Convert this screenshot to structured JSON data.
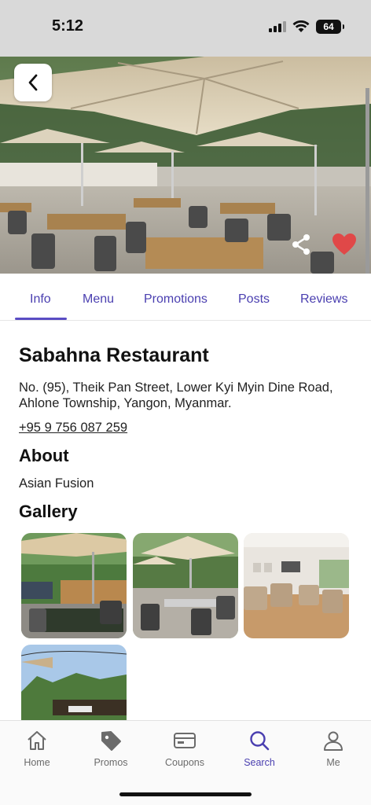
{
  "status_bar": {
    "time": "5:12",
    "battery": "64"
  },
  "tabs": [
    {
      "label": "Info",
      "active": true
    },
    {
      "label": "Menu",
      "active": false
    },
    {
      "label": "Promotions",
      "active": false
    },
    {
      "label": "Posts",
      "active": false
    },
    {
      "label": "Reviews",
      "active": false
    }
  ],
  "restaurant": {
    "name": "Sabahna Restaurant",
    "address_line1": "No. (95), Theik Pan Street, Lower Kyi Myin Dine Road,",
    "address_line2": "Ahlone Township, Yangon, Myanmar.",
    "phone": "+95 9 756 087 259",
    "favorited": true
  },
  "about": {
    "title": "About",
    "text": "Asian Fusion"
  },
  "gallery": {
    "title": "Gallery",
    "photo_count": 4
  },
  "bottom_nav": [
    {
      "label": "Home",
      "icon": "home-icon",
      "active": false
    },
    {
      "label": "Promos",
      "icon": "tag-icon",
      "active": false
    },
    {
      "label": "Coupons",
      "icon": "coupon-icon",
      "active": false
    },
    {
      "label": "Search",
      "icon": "search-icon",
      "active": true
    },
    {
      "label": "Me",
      "icon": "person-icon",
      "active": false
    }
  ],
  "colors": {
    "accent": "#4a3fb0",
    "heart": "#e04848",
    "nav_inactive": "#6b6b6b"
  }
}
